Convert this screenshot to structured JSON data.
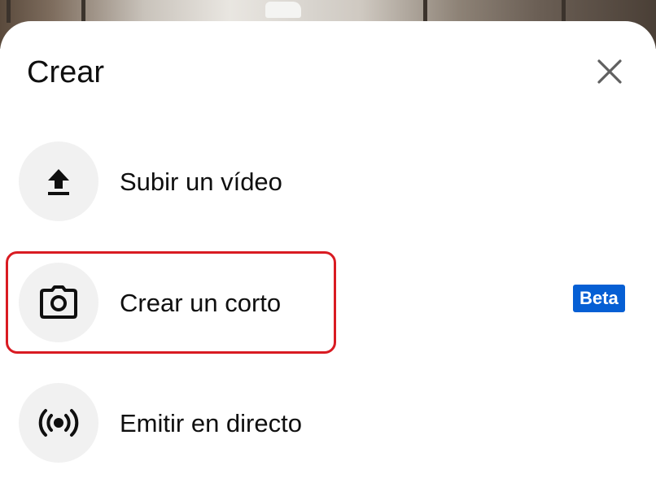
{
  "sheet": {
    "title": "Crear",
    "close_icon": "close-icon"
  },
  "options": [
    {
      "label": "Subir un vídeo",
      "icon": "upload-icon"
    },
    {
      "label": "Crear un corto",
      "icon": "camera-icon",
      "badge": "Beta"
    },
    {
      "label": "Emitir en directo",
      "icon": "live-broadcast-icon"
    }
  ],
  "colors": {
    "badge_bg": "#065fd4",
    "highlight_border": "#d91b22",
    "icon_circle_bg": "#f1f1f1"
  }
}
